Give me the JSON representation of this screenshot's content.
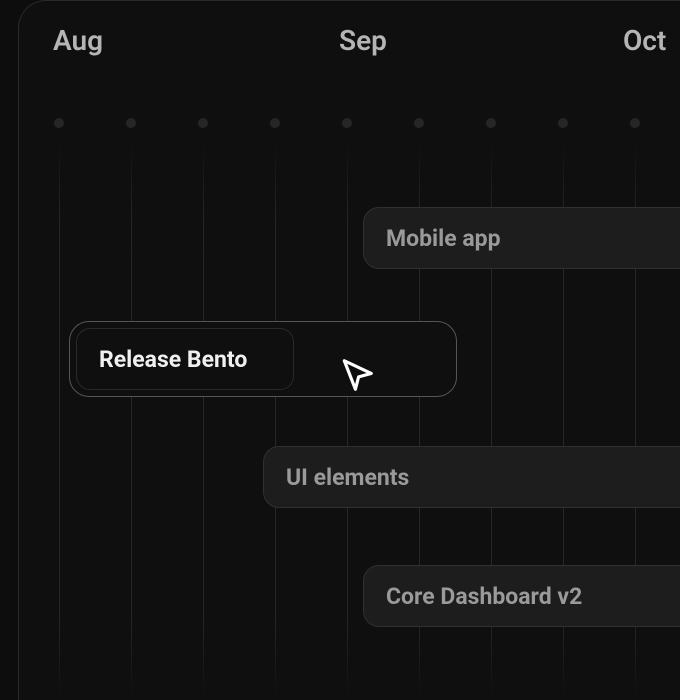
{
  "timeline": {
    "months": [
      "Aug",
      "Sep",
      "Oct"
    ],
    "columns": [
      40,
      112,
      184,
      256,
      328,
      400,
      472,
      544,
      616
    ]
  },
  "tasks": {
    "mobile": {
      "label": "Mobile app"
    },
    "release": {
      "label": "Release Bento"
    },
    "ui": {
      "label": "UI elements"
    },
    "core": {
      "label": "Core Dashboard v2"
    }
  }
}
